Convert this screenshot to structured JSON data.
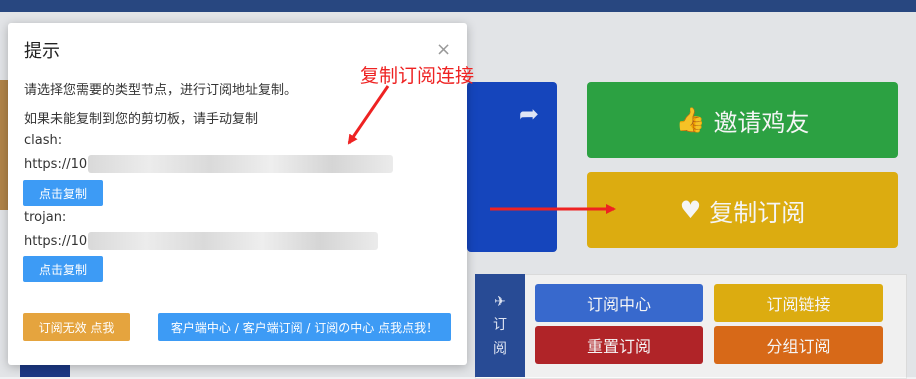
{
  "background": {
    "blue_tile_icon": "share-arrow",
    "invite_label": "邀请鸡友",
    "invite_icon": "thumbs-up",
    "copy_sub_label": "复制订阅",
    "copy_sub_icon": "heart",
    "panel_side_label_1": "订",
    "panel_side_label_2": "阅",
    "tiles": [
      "订阅中心",
      "订阅链接",
      "重置订阅",
      "分组订阅"
    ]
  },
  "modal": {
    "title": "提示",
    "close_glyph": "×",
    "line1": "请选择您需要的类型节点，进行订阅地址复制。",
    "line2": "如果未能复制到您的剪切板，请手动复制",
    "clash_label": "clash:",
    "clash_url": "https://103",
    "copy_btn_1": "点击复制",
    "trojan_label": "trojan:",
    "trojan_url": "https://103",
    "copy_btn_2": "点击复制",
    "invalid_btn": "订阅无效 点我",
    "client_btn": "客户端中心 / 客户端订阅 / 订阅の中心 点我点我！"
  },
  "annotation": {
    "text": "复制订阅连接",
    "color": "#ee2222"
  }
}
